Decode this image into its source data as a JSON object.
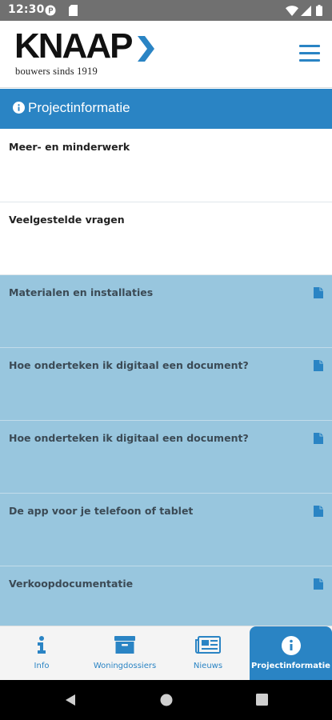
{
  "status_bar": {
    "time": "12:30",
    "icons": [
      "sync-circle-icon",
      "sd-card-icon",
      "wifi-icon",
      "signal-icon",
      "battery-icon"
    ]
  },
  "header": {
    "logo_text": "KNAAP",
    "logo_tagline": "bouwers sinds 1919",
    "menu_icon": "hamburger-menu-icon"
  },
  "section": {
    "title": "Projectinformatie",
    "icon": "info-circle-icon"
  },
  "items": [
    {
      "label": "Meer- en minderwerk",
      "has_document_icon": false
    },
    {
      "label": "Veelgestelde vragen",
      "has_document_icon": false
    },
    {
      "label": "Materialen en installaties",
      "has_document_icon": true
    },
    {
      "label": "Hoe onderteken ik digitaal een document?",
      "has_document_icon": true
    },
    {
      "label": "Hoe onderteken ik digitaal een document?",
      "has_document_icon": true
    },
    {
      "label": "De app voor je telefoon of tablet",
      "has_document_icon": true
    },
    {
      "label": "Verkoopdocumentatie",
      "has_document_icon": true
    }
  ],
  "tabs": [
    {
      "label": "Info",
      "icon": "info-icon",
      "active": false
    },
    {
      "label": "Woningdossiers",
      "icon": "archive-box-icon",
      "active": false
    },
    {
      "label": "Nieuws",
      "icon": "newspaper-icon",
      "active": false
    },
    {
      "label": "Projectinformatie",
      "icon": "info-circle-icon",
      "active": true
    }
  ],
  "colors": {
    "brand_blue": "#2a84c4",
    "item_blue": "#98c6de",
    "status_bar": "#707070"
  }
}
